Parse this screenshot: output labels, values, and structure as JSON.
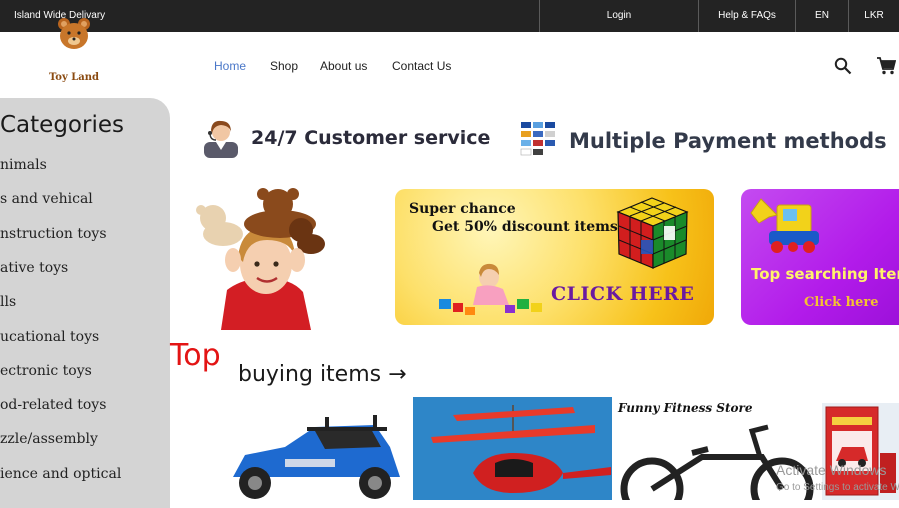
{
  "topbar": {
    "delivery": "Island Wide Delivary",
    "login": "Login",
    "help": "Help & FAQs",
    "lang": "EN",
    "currency": "LKR"
  },
  "logo": {
    "text": "Toy Land"
  },
  "nav": {
    "items": [
      {
        "label": "Home",
        "active": true
      },
      {
        "label": "Shop"
      },
      {
        "label": "About us"
      },
      {
        "label": "Contact Us"
      }
    ],
    "icons": [
      "search-icon",
      "cart-icon"
    ]
  },
  "sidebar": {
    "title": "Categories",
    "items": [
      "nimals",
      "s and vehical",
      "nstruction toys",
      "ative toys",
      "lls",
      "ucational toys",
      "ectronic toys",
      "od-related toys",
      "zzle/assembly",
      "ience and optical"
    ]
  },
  "services": {
    "customer": "24/7 Customer service",
    "payment": "Multiple Payment methods"
  },
  "banners": {
    "discount": {
      "line1": "Super chance",
      "line2": "Get 50% discount items",
      "cta": "CLICK HERE"
    },
    "search": {
      "title": "Top searching Item",
      "cta": "Click here"
    }
  },
  "top_buying": {
    "top": "Top",
    "rest": "buying items",
    "arrow": "→"
  },
  "products": {
    "fitness_store": "Funny Fitness Store"
  },
  "watermark": {
    "line1": "Activate Windows",
    "line2": "Go to Settings to activate Windows."
  },
  "colors": {
    "topbar_bg": "#232323",
    "nav_active": "#4a77c8",
    "sidebar_bg": "#d4d4d4",
    "top_red": "#e31414",
    "discount_bg": "#f7c21a",
    "search_bg": "#b21bea"
  }
}
